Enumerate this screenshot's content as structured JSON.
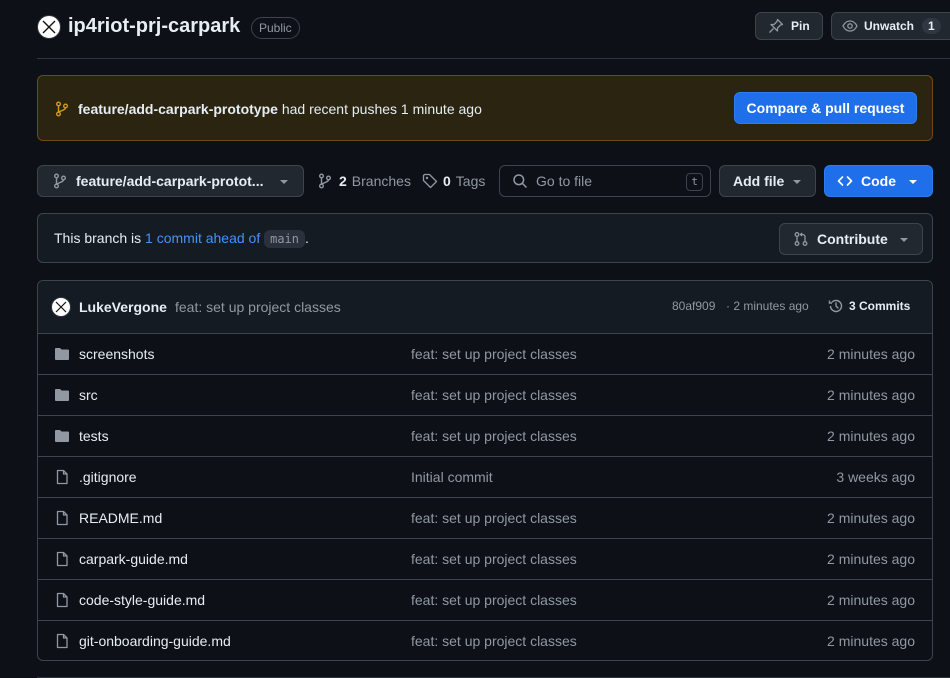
{
  "repo": {
    "name": "ip4riot-prj-carpark",
    "visibility": "Public"
  },
  "header_actions": {
    "pin_label": "Pin",
    "watch_label": "Unwatch",
    "watch_count": "1"
  },
  "banner": {
    "branch": "feature/add-carpark-prototype",
    "message": "had recent pushes 1 minute ago",
    "compare_label": "Compare & pull request"
  },
  "toolbar": {
    "branch_select": "feature/add-carpark-protot...",
    "branches_count": "2",
    "branches_label": "Branches",
    "tags_count": "0",
    "tags_label": "Tags",
    "search_placeholder": "Go to file",
    "search_shortcut": "t",
    "add_file_label": "Add file",
    "code_label": "Code"
  },
  "ahead": {
    "prefix": "This branch is",
    "link": "1 commit ahead of",
    "base": "main",
    "suffix": ".",
    "contribute_label": "Contribute"
  },
  "latest_commit": {
    "author": "LukeVergone",
    "message": "feat: set up project classes",
    "hash": "80af909",
    "time": "· 2 minutes ago",
    "commits_label": "3 Commits"
  },
  "files": [
    {
      "name": "screenshots",
      "type": "folder",
      "message": "feat: set up project classes",
      "time": "2 minutes ago"
    },
    {
      "name": "src",
      "type": "folder",
      "message": "feat: set up project classes",
      "time": "2 minutes ago"
    },
    {
      "name": "tests",
      "type": "folder",
      "message": "feat: set up project classes",
      "time": "2 minutes ago"
    },
    {
      "name": ".gitignore",
      "type": "file",
      "message": "Initial commit",
      "time": "3 weeks ago"
    },
    {
      "name": "README.md",
      "type": "file",
      "message": "feat: set up project classes",
      "time": "2 minutes ago"
    },
    {
      "name": "carpark-guide.md",
      "type": "file",
      "message": "feat: set up project classes",
      "time": "2 minutes ago"
    },
    {
      "name": "code-style-guide.md",
      "type": "file",
      "message": "feat: set up project classes",
      "time": "2 minutes ago"
    },
    {
      "name": "git-onboarding-guide.md",
      "type": "file",
      "message": "feat: set up project classes",
      "time": "2 minutes ago"
    }
  ],
  "colors": {
    "accent": "#1f6feb",
    "link": "#4493f8",
    "banner_bg": "#2a2410",
    "banner_border": "#6b4d0f",
    "branch_icon": "#d29922",
    "folder_icon": "#9198a1"
  }
}
